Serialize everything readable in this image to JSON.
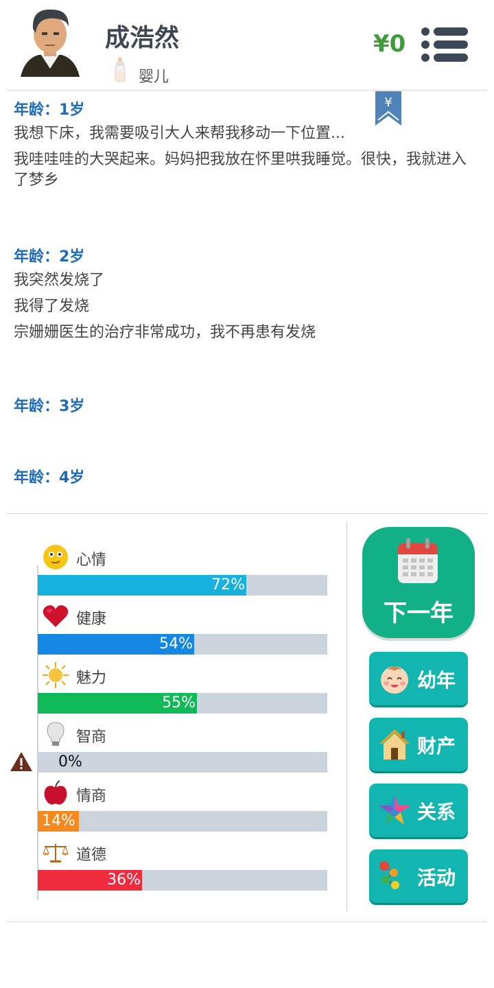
{
  "header": {
    "name": "成浩然",
    "stage": "婴儿",
    "money": "¥0"
  },
  "log": [
    {
      "age": "年龄：1岁",
      "lines": [
        "我想下床，我需要吸引大人来帮我移动一下位置...",
        "我哇哇哇的大哭起来。妈妈把我放在怀里哄我睡觉。很快，我就进入了梦乡"
      ]
    },
    {
      "age": "年龄：2岁",
      "lines": [
        "我突然发烧了",
        "我得了发烧",
        "宗姗姗医生的治疗非常成功，我不再患有发烧"
      ]
    },
    {
      "age": "年龄：3岁",
      "lines": []
    },
    {
      "age": "年龄：4岁",
      "lines": []
    }
  ],
  "bookmark_symbol": "¥",
  "stats": [
    {
      "label": "心情",
      "value": 72,
      "text": "72%",
      "color": "#16b1dc",
      "icon": "smiley-icon"
    },
    {
      "label": "健康",
      "value": 54,
      "text": "54%",
      "color": "#1487e2",
      "icon": "heart-icon"
    },
    {
      "label": "魅力",
      "value": 55,
      "text": "55%",
      "color": "#10b957",
      "icon": "sun-icon"
    },
    {
      "label": "智商",
      "value": 0,
      "text": "0%",
      "color": "#888888",
      "icon": "lightbulb-icon"
    },
    {
      "label": "情商",
      "value": 14,
      "text": "14%",
      "color": "#f4891e",
      "icon": "apple-icon"
    },
    {
      "label": "道德",
      "value": 36,
      "text": "36%",
      "color": "#ef2b3e",
      "icon": "scales-icon"
    }
  ],
  "buttons": {
    "next_year": "下一年",
    "childhood": "幼年",
    "assets": "财产",
    "relations": "关系",
    "activities": "活动"
  }
}
